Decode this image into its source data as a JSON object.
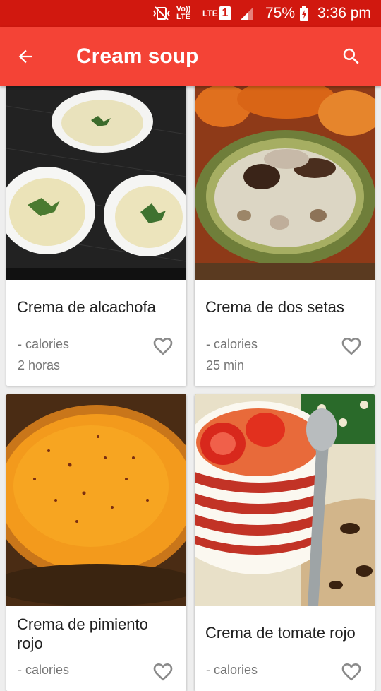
{
  "status_bar": {
    "volte": "Vo)) LTE",
    "lte": "LTE",
    "sim": "1",
    "battery": "75%",
    "time": "3:36 pm"
  },
  "app_bar": {
    "title": "Cream soup",
    "back_icon": "arrow-back-icon",
    "search_icon": "search-icon"
  },
  "recipes": [
    {
      "name": "Crema de alcachofa",
      "calories": "- calories",
      "time": "2 horas"
    },
    {
      "name": "Crema de dos setas",
      "calories": "- calories",
      "time": "25 min"
    },
    {
      "name": "Crema de pimiento rojo",
      "calories": "- calories"
    },
    {
      "name": "Crema de tomate rojo",
      "calories": "- calories"
    }
  ],
  "colors": {
    "status_bar": "#d1180f",
    "app_bar": "#f44336"
  }
}
